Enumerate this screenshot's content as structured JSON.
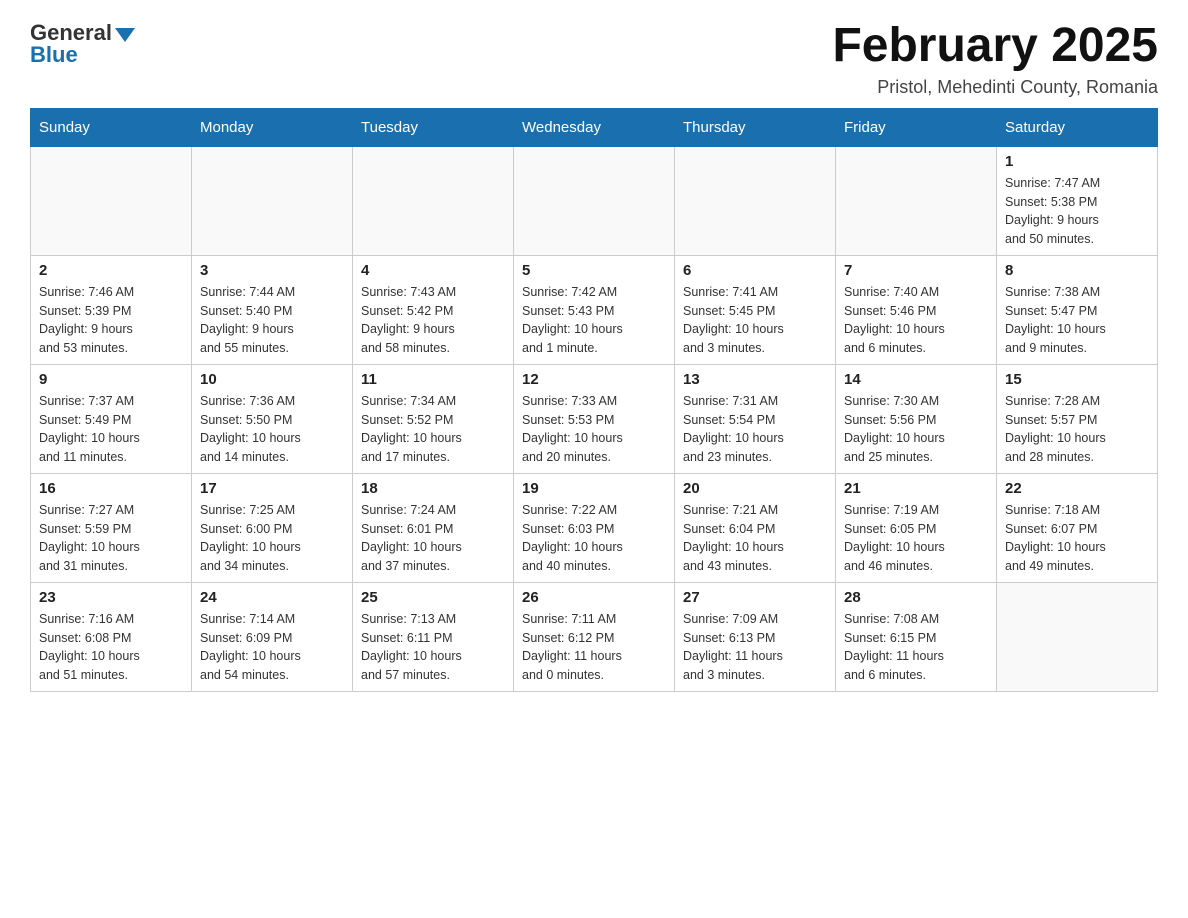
{
  "header": {
    "logo_general": "General",
    "logo_blue": "Blue",
    "title": "February 2025",
    "subtitle": "Pristol, Mehedinti County, Romania"
  },
  "days_of_week": [
    "Sunday",
    "Monday",
    "Tuesday",
    "Wednesday",
    "Thursday",
    "Friday",
    "Saturday"
  ],
  "weeks": [
    [
      {
        "day": "",
        "info": ""
      },
      {
        "day": "",
        "info": ""
      },
      {
        "day": "",
        "info": ""
      },
      {
        "day": "",
        "info": ""
      },
      {
        "day": "",
        "info": ""
      },
      {
        "day": "",
        "info": ""
      },
      {
        "day": "1",
        "info": "Sunrise: 7:47 AM\nSunset: 5:38 PM\nDaylight: 9 hours\nand 50 minutes."
      }
    ],
    [
      {
        "day": "2",
        "info": "Sunrise: 7:46 AM\nSunset: 5:39 PM\nDaylight: 9 hours\nand 53 minutes."
      },
      {
        "day": "3",
        "info": "Sunrise: 7:44 AM\nSunset: 5:40 PM\nDaylight: 9 hours\nand 55 minutes."
      },
      {
        "day": "4",
        "info": "Sunrise: 7:43 AM\nSunset: 5:42 PM\nDaylight: 9 hours\nand 58 minutes."
      },
      {
        "day": "5",
        "info": "Sunrise: 7:42 AM\nSunset: 5:43 PM\nDaylight: 10 hours\nand 1 minute."
      },
      {
        "day": "6",
        "info": "Sunrise: 7:41 AM\nSunset: 5:45 PM\nDaylight: 10 hours\nand 3 minutes."
      },
      {
        "day": "7",
        "info": "Sunrise: 7:40 AM\nSunset: 5:46 PM\nDaylight: 10 hours\nand 6 minutes."
      },
      {
        "day": "8",
        "info": "Sunrise: 7:38 AM\nSunset: 5:47 PM\nDaylight: 10 hours\nand 9 minutes."
      }
    ],
    [
      {
        "day": "9",
        "info": "Sunrise: 7:37 AM\nSunset: 5:49 PM\nDaylight: 10 hours\nand 11 minutes."
      },
      {
        "day": "10",
        "info": "Sunrise: 7:36 AM\nSunset: 5:50 PM\nDaylight: 10 hours\nand 14 minutes."
      },
      {
        "day": "11",
        "info": "Sunrise: 7:34 AM\nSunset: 5:52 PM\nDaylight: 10 hours\nand 17 minutes."
      },
      {
        "day": "12",
        "info": "Sunrise: 7:33 AM\nSunset: 5:53 PM\nDaylight: 10 hours\nand 20 minutes."
      },
      {
        "day": "13",
        "info": "Sunrise: 7:31 AM\nSunset: 5:54 PM\nDaylight: 10 hours\nand 23 minutes."
      },
      {
        "day": "14",
        "info": "Sunrise: 7:30 AM\nSunset: 5:56 PM\nDaylight: 10 hours\nand 25 minutes."
      },
      {
        "day": "15",
        "info": "Sunrise: 7:28 AM\nSunset: 5:57 PM\nDaylight: 10 hours\nand 28 minutes."
      }
    ],
    [
      {
        "day": "16",
        "info": "Sunrise: 7:27 AM\nSunset: 5:59 PM\nDaylight: 10 hours\nand 31 minutes."
      },
      {
        "day": "17",
        "info": "Sunrise: 7:25 AM\nSunset: 6:00 PM\nDaylight: 10 hours\nand 34 minutes."
      },
      {
        "day": "18",
        "info": "Sunrise: 7:24 AM\nSunset: 6:01 PM\nDaylight: 10 hours\nand 37 minutes."
      },
      {
        "day": "19",
        "info": "Sunrise: 7:22 AM\nSunset: 6:03 PM\nDaylight: 10 hours\nand 40 minutes."
      },
      {
        "day": "20",
        "info": "Sunrise: 7:21 AM\nSunset: 6:04 PM\nDaylight: 10 hours\nand 43 minutes."
      },
      {
        "day": "21",
        "info": "Sunrise: 7:19 AM\nSunset: 6:05 PM\nDaylight: 10 hours\nand 46 minutes."
      },
      {
        "day": "22",
        "info": "Sunrise: 7:18 AM\nSunset: 6:07 PM\nDaylight: 10 hours\nand 49 minutes."
      }
    ],
    [
      {
        "day": "23",
        "info": "Sunrise: 7:16 AM\nSunset: 6:08 PM\nDaylight: 10 hours\nand 51 minutes."
      },
      {
        "day": "24",
        "info": "Sunrise: 7:14 AM\nSunset: 6:09 PM\nDaylight: 10 hours\nand 54 minutes."
      },
      {
        "day": "25",
        "info": "Sunrise: 7:13 AM\nSunset: 6:11 PM\nDaylight: 10 hours\nand 57 minutes."
      },
      {
        "day": "26",
        "info": "Sunrise: 7:11 AM\nSunset: 6:12 PM\nDaylight: 11 hours\nand 0 minutes."
      },
      {
        "day": "27",
        "info": "Sunrise: 7:09 AM\nSunset: 6:13 PM\nDaylight: 11 hours\nand 3 minutes."
      },
      {
        "day": "28",
        "info": "Sunrise: 7:08 AM\nSunset: 6:15 PM\nDaylight: 11 hours\nand 6 minutes."
      },
      {
        "day": "",
        "info": ""
      }
    ]
  ]
}
